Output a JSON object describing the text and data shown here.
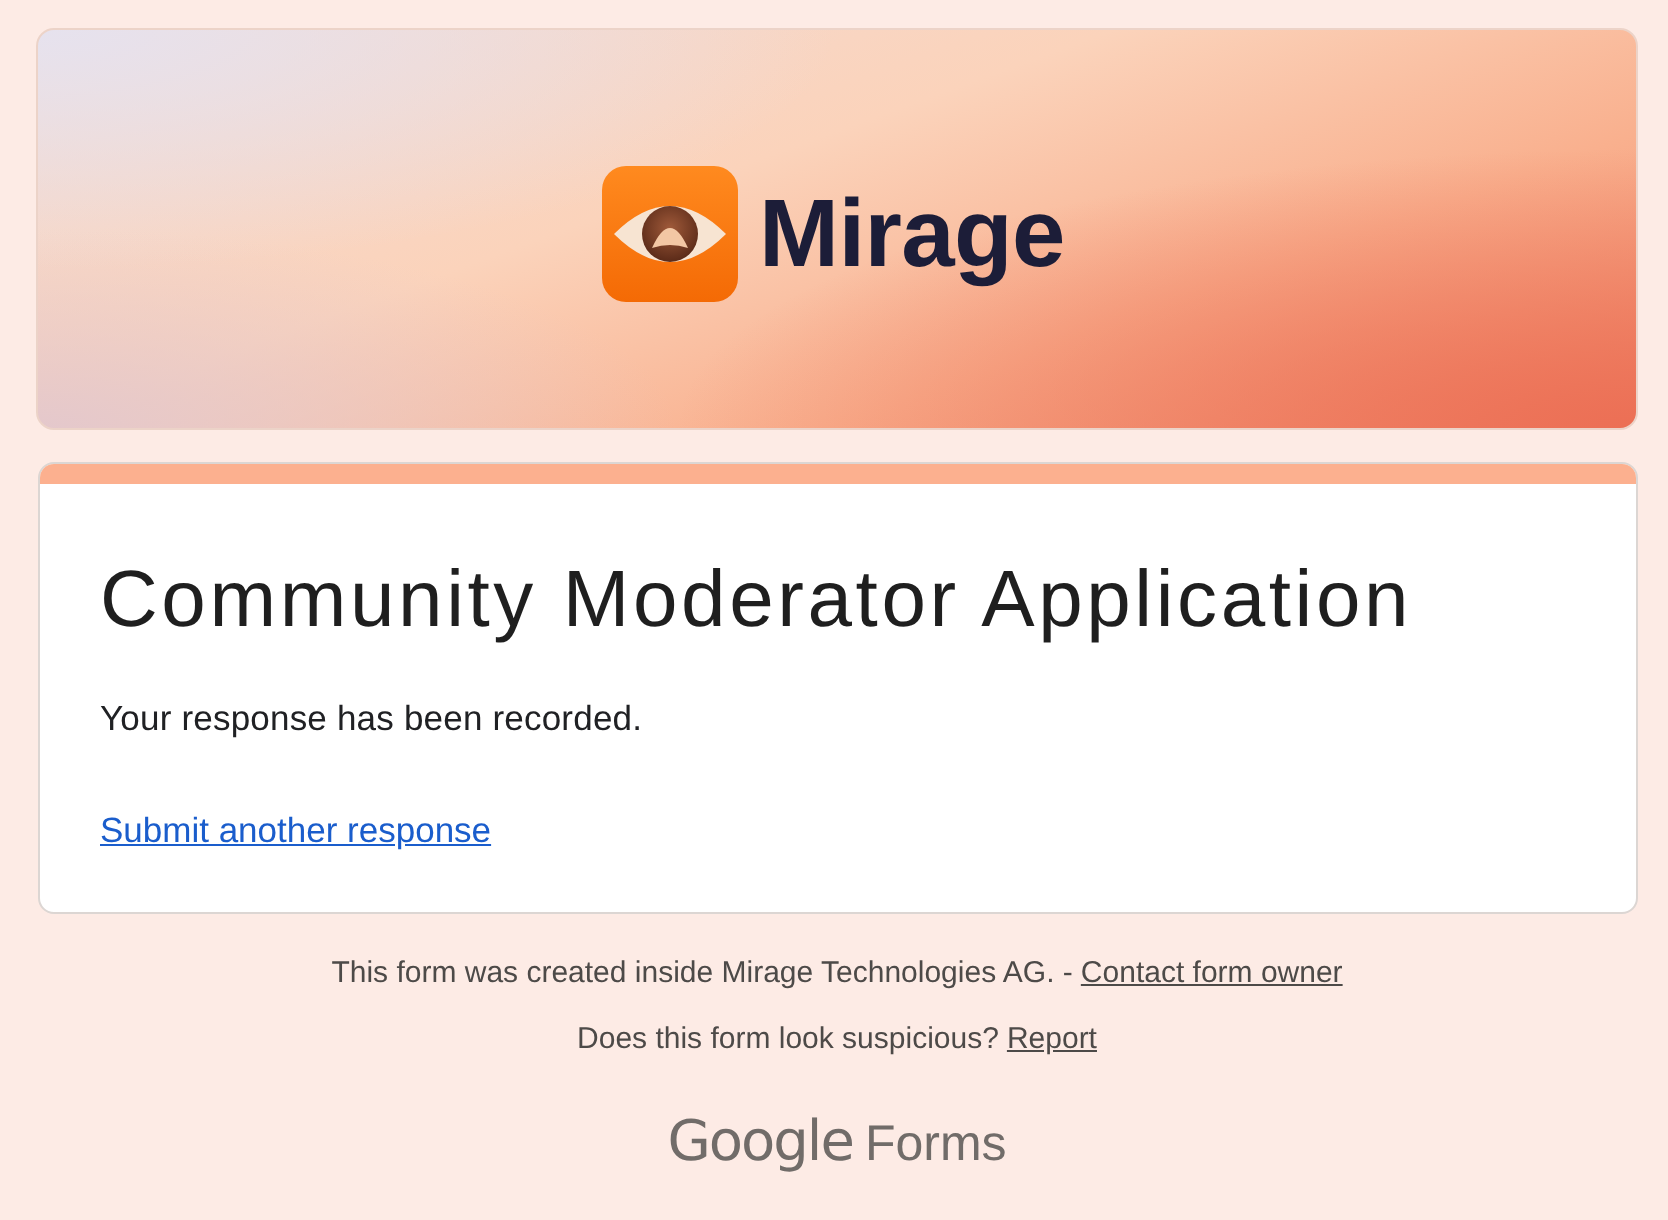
{
  "banner": {
    "brand": "Mirage"
  },
  "card": {
    "title": "Community Moderator Application",
    "message": "Your response has been recorded.",
    "link": "Submit another response"
  },
  "footer": {
    "lines": [
      {
        "text": "This form was created inside Mirage Technologies AG. -",
        "link": "Contact form owner"
      },
      {
        "text": "Does this form look suspicious?",
        "link": "Report"
      }
    ]
  },
  "product_logo": {
    "brand": "Google",
    "product": "Forms"
  }
}
